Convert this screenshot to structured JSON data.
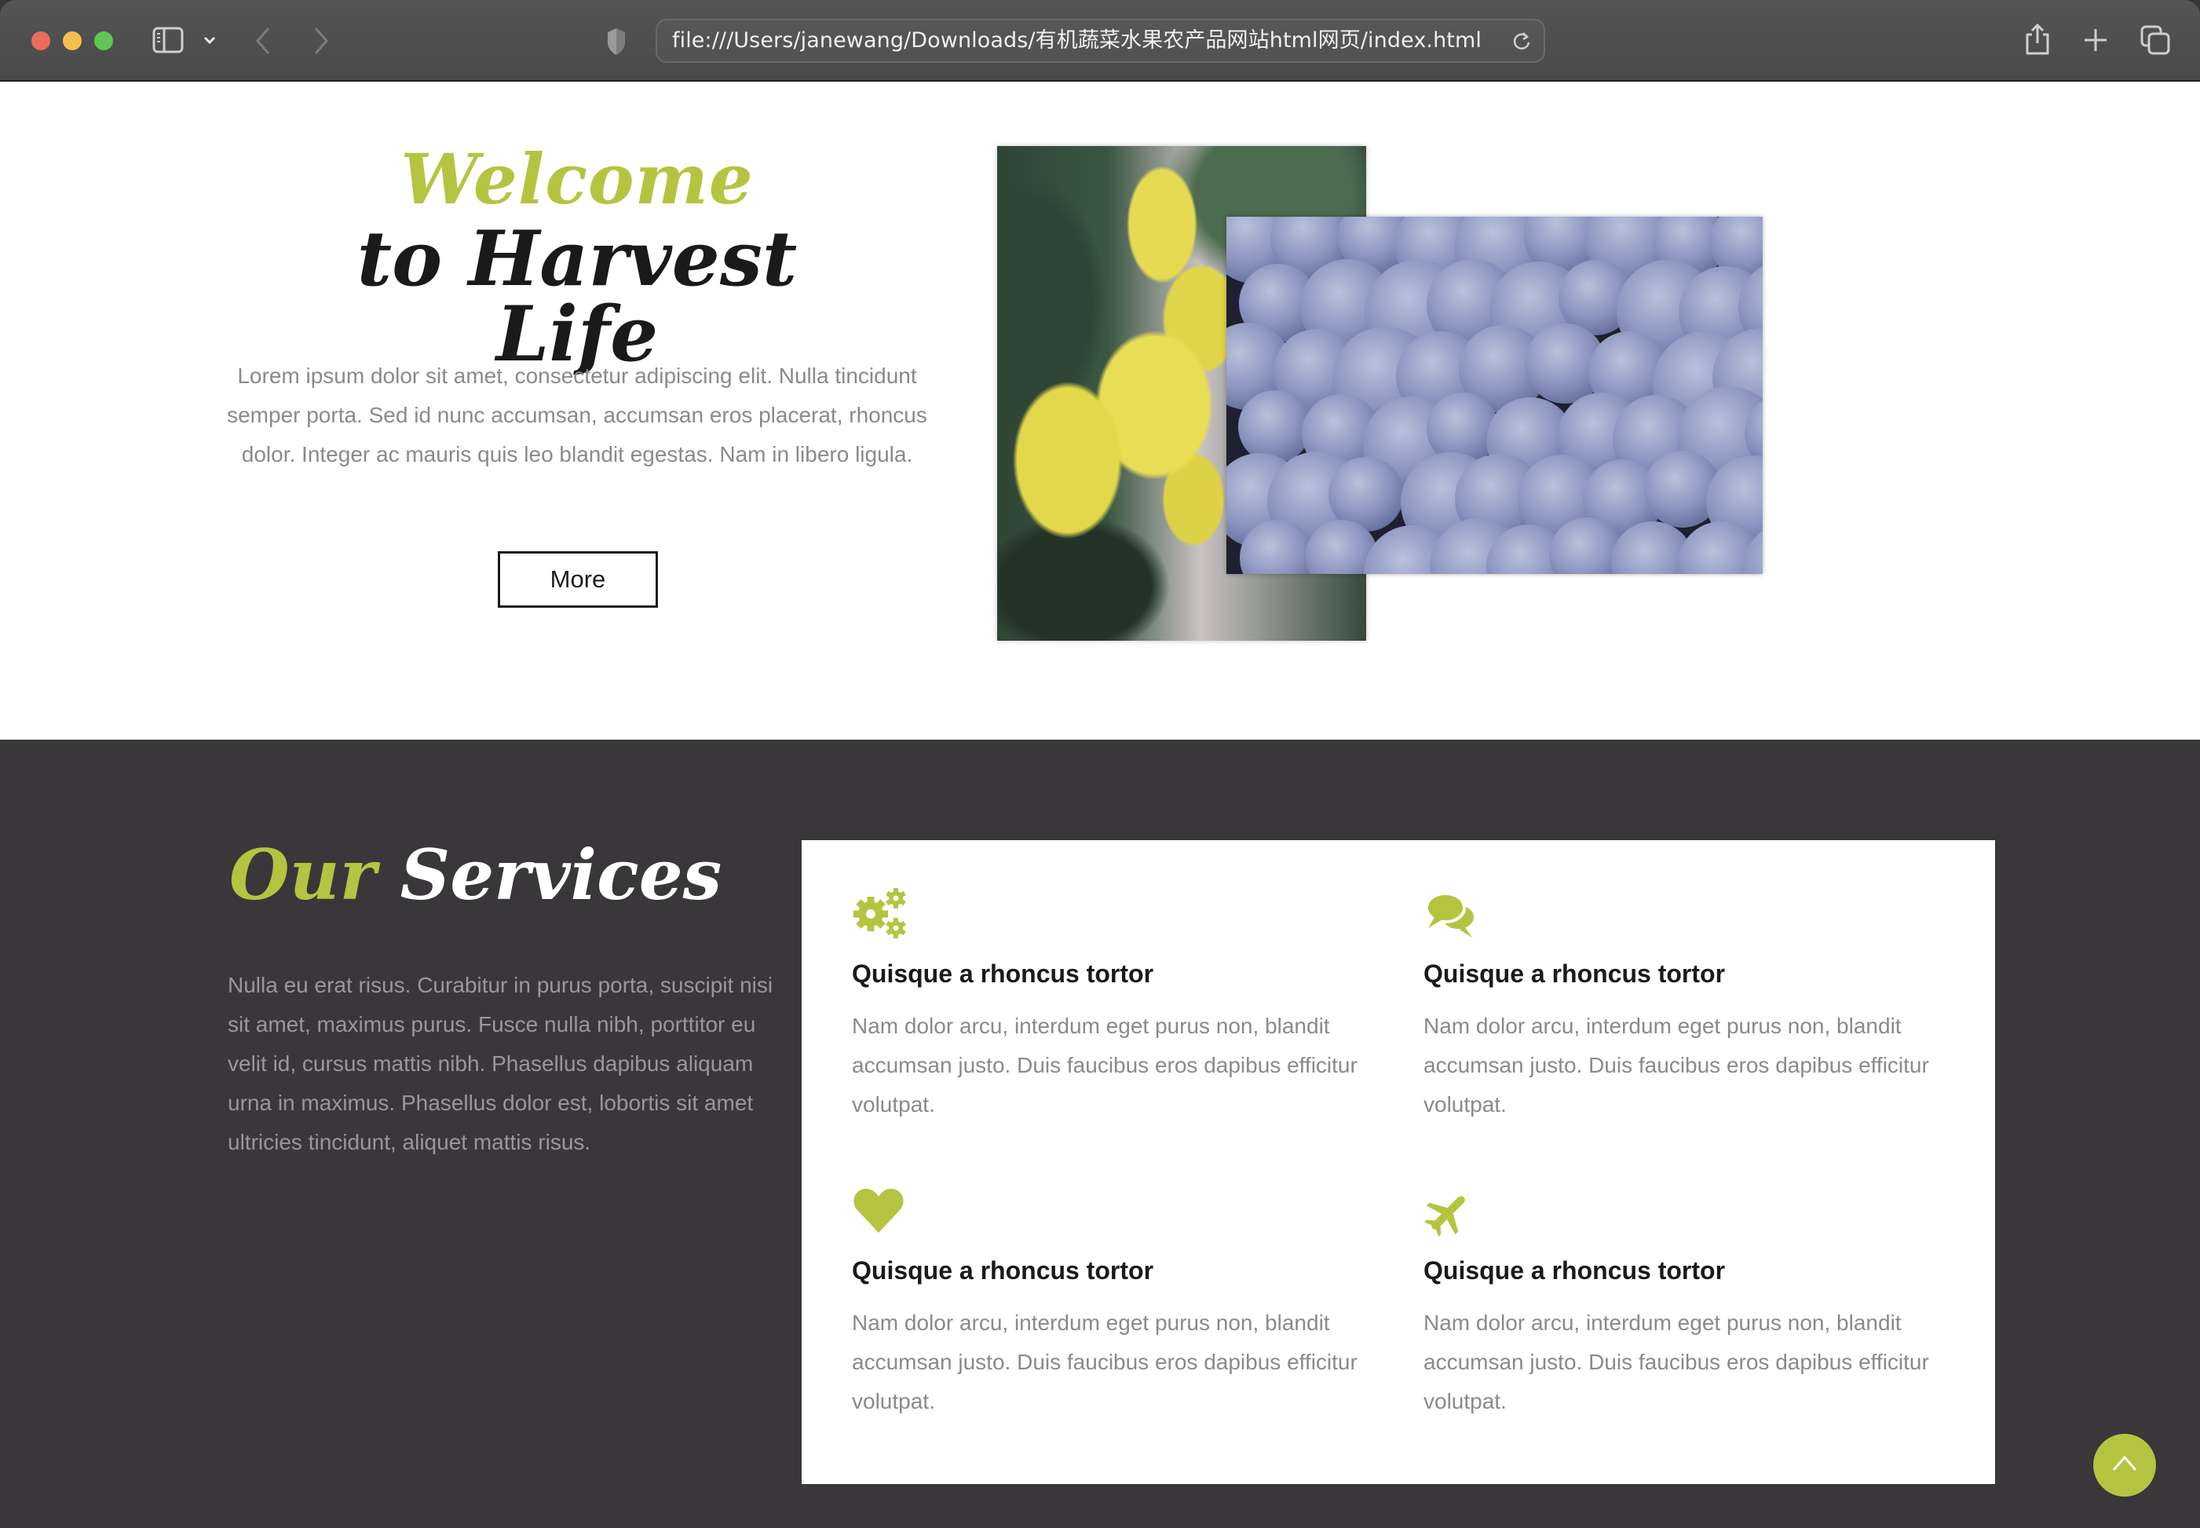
{
  "browser": {
    "url": "file:///Users/janewang/Downloads/有机蔬菜水果农产品网站html网页/index.html",
    "icons": [
      "close-light",
      "minimize-light",
      "zoom-light",
      "sidebar-icon",
      "chevron-down-icon",
      "back-icon",
      "forward-icon",
      "shield-icon",
      "reload-icon",
      "share-icon",
      "new-tab-icon",
      "tab-overview-icon"
    ]
  },
  "colors": {
    "accent": "#b5c440",
    "dark_section": "#3a373b",
    "heading_dark": "#1a1a1a",
    "body_text": "#8a8a8a"
  },
  "hero": {
    "title_accent": "Welcome",
    "title_main": "to Harvest Life",
    "paragraph": "Lorem ipsum dolor sit amet, consectetur adipiscing elit. Nulla tincidunt semper porta. Sed id nunc accumsan, accumsan eros placerat, rhoncus dolor. Integer ac mauris quis leo blandit egestas. Nam in libero ligula.",
    "more_label": "More",
    "images": [
      {
        "alt": "Lemons on a tree"
      },
      {
        "alt": "Blueberries"
      }
    ]
  },
  "services": {
    "title_accent": "Our",
    "title_main": "Services",
    "paragraph": "Nulla eu erat risus. Curabitur in purus porta, suscipit nisi sit amet, maximus purus. Fusce nulla nibh, porttitor eu velit id, cursus mattis nibh. Phasellus dapibus aliquam urna in maximus. Phasellus dolor est, lobortis sit amet ultricies tincidunt, aliquet mattis risus.",
    "items": [
      {
        "icon": "gears-icon",
        "title": "Quisque a rhoncus tortor",
        "text": "Nam dolor arcu, interdum eget purus non, blandit accumsan justo. Duis faucibus eros dapibus efficitur volutpat."
      },
      {
        "icon": "comments-icon",
        "title": "Quisque a rhoncus tortor",
        "text": "Nam dolor arcu, interdum eget purus non, blandit accumsan justo. Duis faucibus eros dapibus efficitur volutpat."
      },
      {
        "icon": "heart-icon",
        "title": "Quisque a rhoncus tortor",
        "text": "Nam dolor arcu, interdum eget purus non, blandit accumsan justo. Duis faucibus eros dapibus efficitur volutpat."
      },
      {
        "icon": "plane-icon",
        "title": "Quisque a rhoncus tortor",
        "text": "Nam dolor arcu, interdum eget purus non, blandit accumsan justo. Duis faucibus eros dapibus efficitur volutpat."
      }
    ]
  },
  "scroll_top": {
    "icon": "chevron-up-icon"
  }
}
